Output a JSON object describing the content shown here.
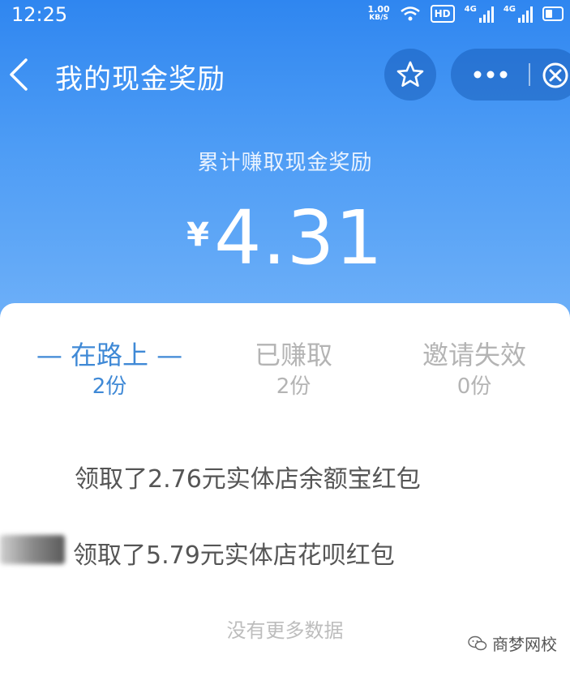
{
  "status_bar": {
    "time": "12:25",
    "net_speed_value": "1.00",
    "net_speed_unit": "KB/S",
    "hd_badge": "HD",
    "signal_1_label": "4G",
    "signal_2_label": "4G"
  },
  "nav": {
    "title": "我的现金奖励",
    "icons": [
      "chevron-left-icon",
      "star-icon",
      "more-icon",
      "close-icon"
    ]
  },
  "summary": {
    "label": "累计赚取现金奖励",
    "currency": "¥",
    "amount": "4.31"
  },
  "tabs": [
    {
      "label": "— 在路上 —",
      "count": "2份",
      "active": true
    },
    {
      "label": "已赚取",
      "count": "2份",
      "active": false
    },
    {
      "label": "邀请失效",
      "count": "0份",
      "active": false
    }
  ],
  "records": [
    {
      "text": "领取了2.76元实体店余额宝红包"
    },
    {
      "text": "领取了5.79元实体店花呗红包"
    }
  ],
  "footer": {
    "no_more": "没有更多数据"
  },
  "watermark": {
    "text": "商梦网校"
  },
  "colors": {
    "header_top": "#2f86f0",
    "header_bottom": "#6eb0f8",
    "active_tab": "#3f89d6",
    "inactive_tab": "#b4b4b4",
    "record_text": "#555555"
  }
}
